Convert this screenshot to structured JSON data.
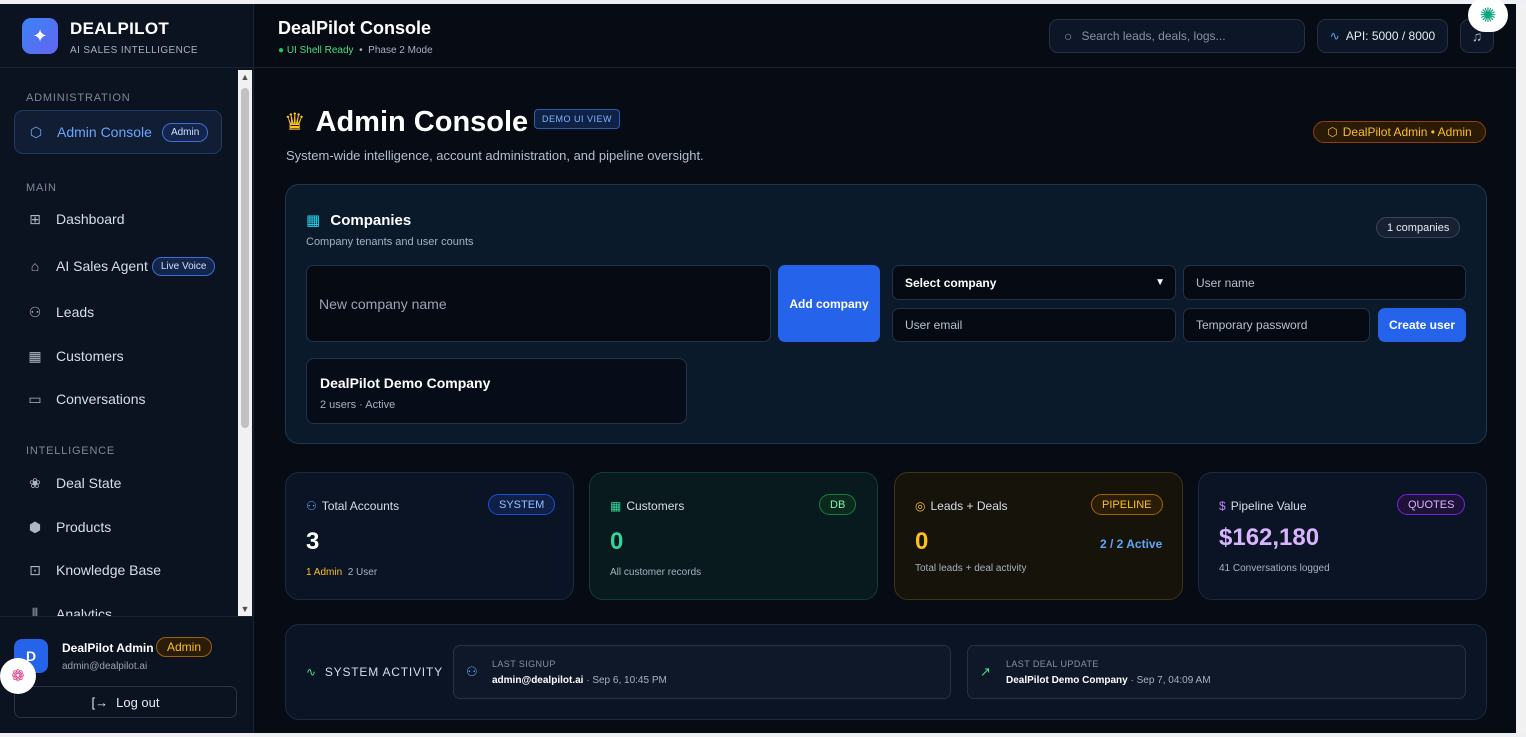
{
  "brand": {
    "name": "DEALPILOT",
    "sub": "AI SALES INTELLIGENCE"
  },
  "sidebar": {
    "sections": {
      "admin": "ADMINISTRATION",
      "main": "MAIN",
      "intel": "INTELLIGENCE"
    },
    "items": [
      {
        "label": "Admin Console",
        "badge": "Admin",
        "icon": "shield-icon"
      },
      {
        "label": "Dashboard",
        "icon": "grid-icon"
      },
      {
        "label": "AI Sales Agent",
        "badge": "Live Voice",
        "icon": "bot-icon"
      },
      {
        "label": "Leads",
        "icon": "users-icon"
      },
      {
        "label": "Customers",
        "icon": "building-icon"
      },
      {
        "label": "Conversations",
        "icon": "chat-icon"
      },
      {
        "label": "Deal State",
        "icon": "brain-icon"
      },
      {
        "label": "Products",
        "icon": "box-icon"
      },
      {
        "label": "Knowledge Base",
        "icon": "book-icon"
      },
      {
        "label": "Analytics",
        "icon": "chart-icon"
      }
    ]
  },
  "user": {
    "initial": "D",
    "name": "DealPilot Admin",
    "role": "Admin",
    "email": "admin@dealpilot.ai",
    "logout": "Log out"
  },
  "topbar": {
    "title": "DealPilot Console",
    "status": "UI Shell Ready",
    "mode": "Phase 2 Mode",
    "search_placeholder": "Search leads, deals, logs...",
    "api": "API: 5000 / 8000"
  },
  "header": {
    "title": "Admin Console",
    "demo_badge": "DEMO UI VIEW",
    "subtitle": "System-wide intelligence, account administration, and pipeline oversight.",
    "admin_pill": "DealPilot Admin • Admin"
  },
  "companies": {
    "title": "Companies",
    "subtitle": "Company tenants and user counts",
    "count": "1 companies",
    "new_company_placeholder": "New company name",
    "add_button": "Add company",
    "select_company": "Select company",
    "user_name_placeholder": "User name",
    "user_email_placeholder": "User email",
    "temp_password_placeholder": "Temporary password",
    "create_button": "Create user",
    "list": [
      {
        "name": "DealPilot Demo Company",
        "meta": "2 users · Active"
      }
    ]
  },
  "stats": [
    {
      "label": "Total Accounts",
      "badge": "SYSTEM",
      "value": "3",
      "foot_highlight": "1 Admin",
      "foot": "2 User",
      "icon": "users-icon"
    },
    {
      "label": "Customers",
      "badge": "DB",
      "value": "0",
      "foot": "All customer records",
      "icon": "building-icon"
    },
    {
      "label": "Leads + Deals",
      "badge": "PIPELINE",
      "value": "0",
      "side": "2 / 2 Active",
      "foot": "Total leads + deal activity",
      "icon": "target-icon"
    },
    {
      "label": "Pipeline Value",
      "badge": "QUOTES",
      "value": "$162,180",
      "foot": "41 Conversations logged",
      "icon": "dollar-icon"
    }
  ],
  "activity": {
    "label": "SYSTEM ACTIVITY",
    "signup_label": "LAST SIGNUP",
    "signup_who": "admin@dealpilot.ai",
    "signup_when": "· Sep 6, 10:45 PM",
    "deal_label": "LAST DEAL UPDATE",
    "deal_who": "DealPilot Demo Company",
    "deal_when": "· Sep 7, 04:09 AM"
  },
  "colors": {
    "accent": "#2563eb",
    "admin_gold": "#fbbf24",
    "green": "#22c55e",
    "purple": "#c084fc"
  }
}
